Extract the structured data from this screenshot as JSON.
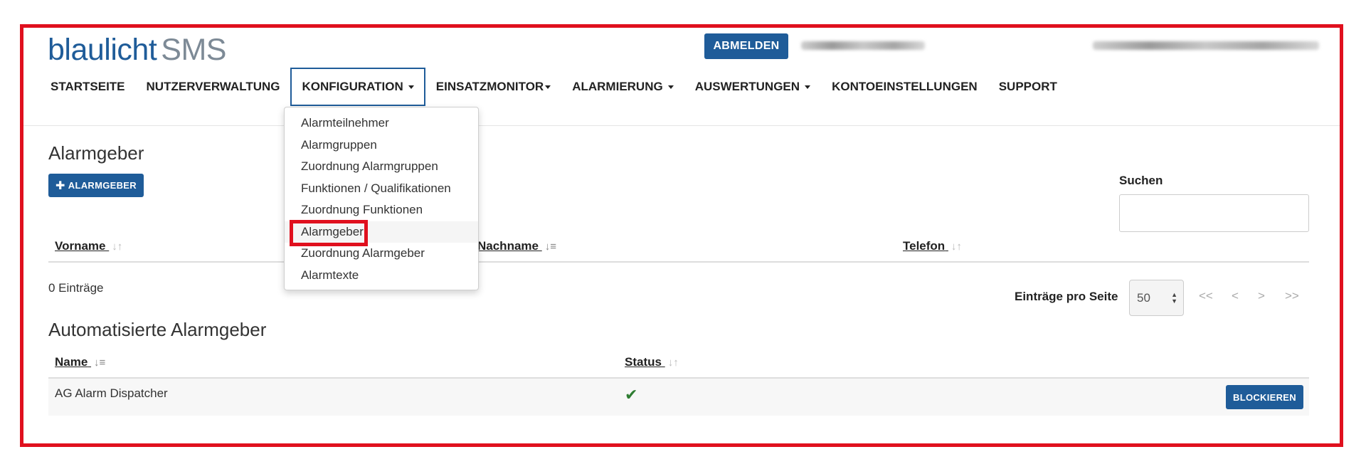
{
  "brand": {
    "part1": "blaulicht",
    "part2": "SMS"
  },
  "header": {
    "logout_label": "ABMELDEN"
  },
  "nav": {
    "items": [
      {
        "label": "STARTSEITE",
        "caret": false
      },
      {
        "label": "NUTZERVERWALTUNG",
        "caret": false
      },
      {
        "label": "KONFIGURATION",
        "caret": true
      },
      {
        "label": "EINSATZMONITOR",
        "caret": true
      },
      {
        "label": "ALARMIERUNG",
        "caret": true
      },
      {
        "label": "AUSWERTUNGEN",
        "caret": true
      },
      {
        "label": "KONTOEINSTELLUNGEN",
        "caret": false
      },
      {
        "label": "SUPPORT",
        "caret": false
      }
    ],
    "active_index": 2
  },
  "dropdown": {
    "items": [
      "Alarmteilnehmer",
      "Alarmgruppen",
      "Zuordnung Alarmgruppen",
      "Funktionen / Qualifikationen",
      "Zuordnung Funktionen",
      "Alarmgeber",
      "Zuordnung Alarmgeber",
      "Alarmtexte"
    ],
    "hover_index": 5
  },
  "section1": {
    "title": "Alarmgeber",
    "add_button": "ALARMGEBER",
    "search_label": "Suchen",
    "search_value": "",
    "columns": [
      "Vorname",
      "Nachname",
      "Telefon"
    ],
    "count_text": "0 Einträge"
  },
  "paging": {
    "label": "Einträge pro Seite",
    "selected": "50",
    "first": "<<",
    "prev": "<",
    "next": ">",
    "last": ">>"
  },
  "section2": {
    "title": "Automatisierte Alarmgeber",
    "columns": [
      "Name",
      "Status"
    ],
    "rows": [
      {
        "name": "AG Alarm Dispatcher",
        "status_icon": "check-icon",
        "action": "BLOCKIEREN"
      }
    ]
  },
  "colors": {
    "brand_blue": "#1f5c99",
    "highlight_red": "#e0101e",
    "status_green": "#2e7d32"
  }
}
